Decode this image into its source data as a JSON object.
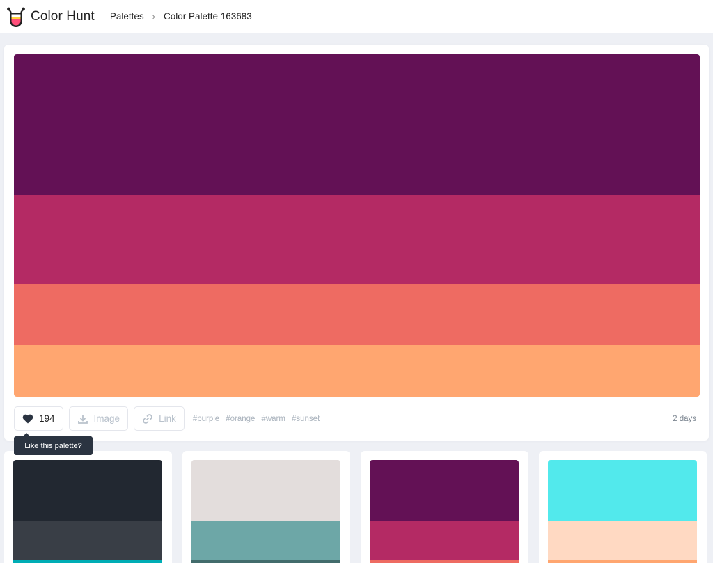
{
  "header": {
    "app_name": "Color Hunt",
    "breadcrumbs": [
      "Palettes",
      "Color Palette 163683"
    ],
    "separator": "›"
  },
  "palette": {
    "colors": [
      "#631155",
      "#B42A64",
      "#EE6B62",
      "#FFA670"
    ],
    "likes": "194",
    "image_label": "Image",
    "link_label": "Link",
    "tags": [
      "#purple",
      "#orange",
      "#warm",
      "#sunset"
    ],
    "date": "2 days",
    "tooltip": "Like this palette?"
  },
  "related": [
    {
      "colors": [
        "#222831",
        "#393E46",
        "#00ADB5"
      ]
    },
    {
      "colors": [
        "#E3DDDC",
        "#6DA7A7",
        "#426C6C"
      ]
    },
    {
      "colors": [
        "#631155",
        "#B42A64",
        "#EE6B62"
      ]
    },
    {
      "colors": [
        "#52E9EC",
        "#FFD9C2",
        "#FFA670"
      ]
    }
  ]
}
